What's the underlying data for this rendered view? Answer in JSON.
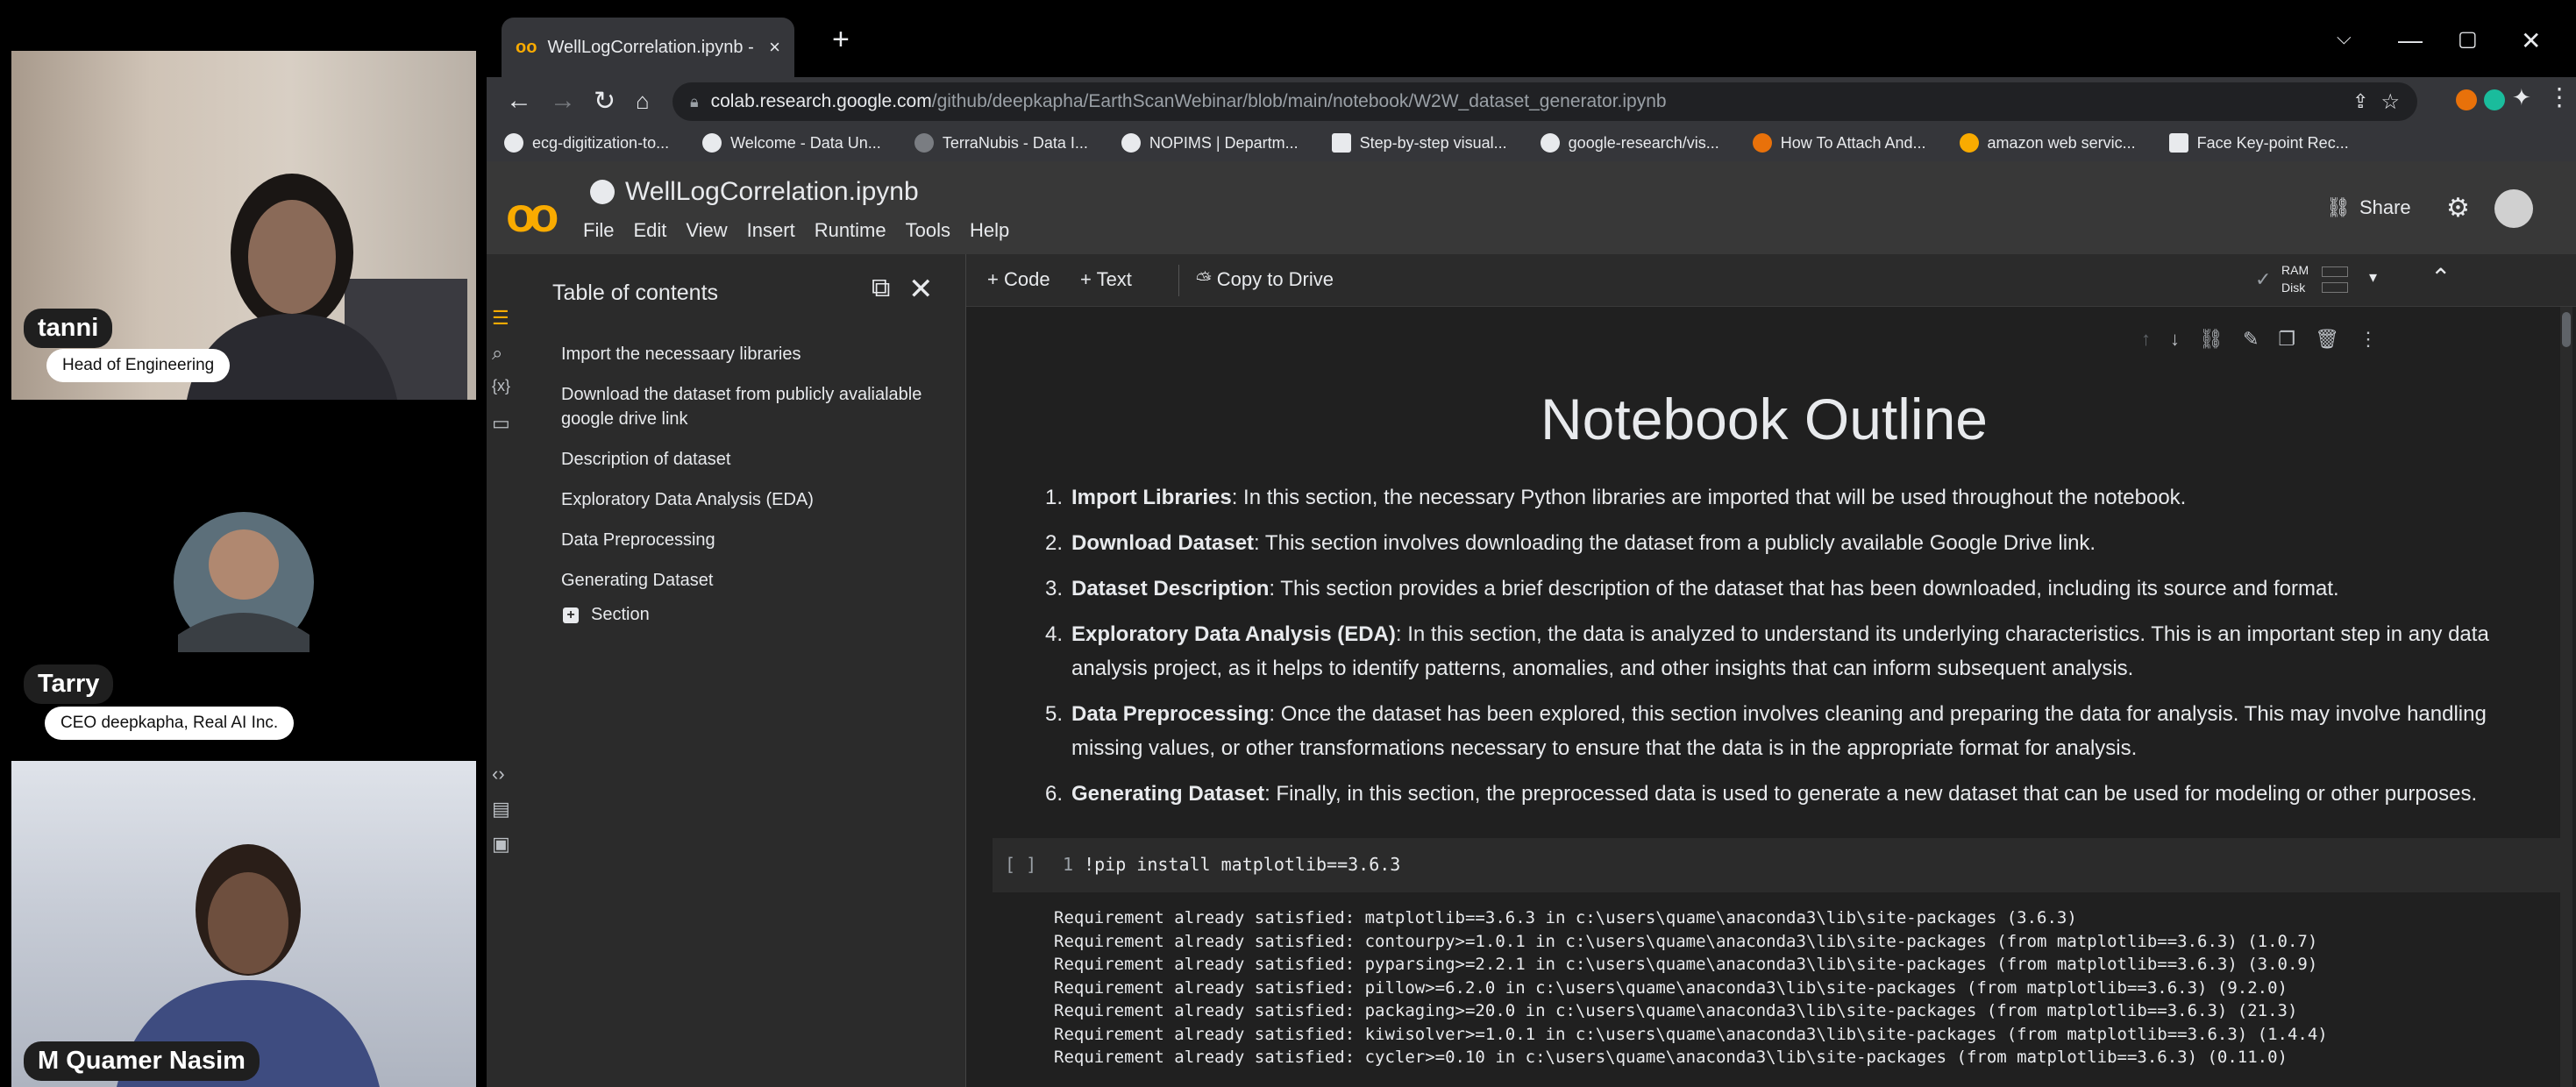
{
  "participants": [
    {
      "name": "tanni",
      "role": "Head of Engineering"
    },
    {
      "name": "Tarry",
      "role": "CEO deepkapha, Real AI Inc."
    },
    {
      "name": "M Quamer Nasim"
    }
  ],
  "browser": {
    "tab_title": "WellLogCorrelation.ipynb - Colab",
    "url_domain": "colab.research.google.com",
    "url_path": "/github/deepkapha/EarthScanWebinar/blob/main/notebook/W2W_dataset_generator.ipynb",
    "bookmarks": [
      "ecg-digitization-to...",
      "Welcome - Data Un...",
      "TerraNubis - Data I...",
      "NOPIMS | Departm...",
      "Step-by-step visual...",
      "google-research/vis...",
      "How To Attach And...",
      "amazon web servic...",
      "Face Key-point Rec..."
    ]
  },
  "colab": {
    "notebook_title": "WellLogCorrelation.ipynb",
    "menu": [
      "File",
      "Edit",
      "View",
      "Insert",
      "Runtime",
      "Tools",
      "Help"
    ],
    "share_label": "Share",
    "toolbar": {
      "code": "+ Code",
      "text": "+ Text",
      "copy_to_drive": "Copy to Drive",
      "ram": "RAM",
      "disk": "Disk"
    },
    "toc": {
      "title": "Table of contents",
      "items": [
        "Import the necessaary libraries",
        "Download the dataset from publicly avalialable google drive link",
        "Description of dataset",
        "Exploratory Data Analysis (EDA)",
        "Data Preprocessing",
        "Generating Dataset"
      ],
      "add_section": "Section"
    },
    "outline": {
      "heading": "Notebook Outline",
      "items": [
        {
          "num": "1.",
          "bold": "Import Libraries",
          "text": ": In this section, the necessary Python libraries are imported that will be used throughout the notebook."
        },
        {
          "num": "2.",
          "bold": "Download Dataset",
          "text": ": This section involves downloading the dataset from a publicly available Google Drive link."
        },
        {
          "num": "3.",
          "bold": "Dataset Description",
          "text": ": This section provides a brief description of the dataset that has been downloaded, including its source and format."
        },
        {
          "num": "4.",
          "bold": "Exploratory Data Analysis (EDA)",
          "text": ": In this section, the data is analyzed to understand its underlying characteristics. This is an important step in any data analysis project, as it helps to identify patterns, anomalies, and other insights that can inform subsequent analysis."
        },
        {
          "num": "5.",
          "bold": "Data Preprocessing",
          "text": ": Once the dataset has been explored, this section involves cleaning and preparing the data for analysis. This may involve handling missing values, or other transformations necessary to ensure that the data is in the appropriate format for analysis."
        },
        {
          "num": "6.",
          "bold": "Generating Dataset",
          "text": ": Finally, in this section, the preprocessed data is used to generate a new dataset that can be used for modeling or other purposes."
        }
      ]
    },
    "code_cell": {
      "bracket": "[ ]",
      "line_no": "1",
      "code": "!pip install matplotlib==3.6.3",
      "output": [
        "Requirement already satisfied: matplotlib==3.6.3 in c:\\users\\quame\\anaconda3\\lib\\site-packages (3.6.3)",
        "Requirement already satisfied: contourpy>=1.0.1 in c:\\users\\quame\\anaconda3\\lib\\site-packages (from matplotlib==3.6.3) (1.0.7)",
        "Requirement already satisfied: pyparsing>=2.2.1 in c:\\users\\quame\\anaconda3\\lib\\site-packages (from matplotlib==3.6.3) (3.0.9)",
        "Requirement already satisfied: pillow>=6.2.0 in c:\\users\\quame\\anaconda3\\lib\\site-packages (from matplotlib==3.6.3) (9.2.0)",
        "Requirement already satisfied: packaging>=20.0 in c:\\users\\quame\\anaconda3\\lib\\site-packages (from matplotlib==3.6.3) (21.3)",
        "Requirement already satisfied: kiwisolver>=1.0.1 in c:\\users\\quame\\anaconda3\\lib\\site-packages (from matplotlib==3.6.3) (1.4.4)",
        "Requirement already satisfied: cycler>=0.10 in c:\\users\\quame\\anaconda3\\lib\\site-packages (from matplotlib==3.6.3) (0.11.0)"
      ]
    }
  },
  "colors": {
    "colab_orange": "#f9ab00",
    "dark_bg": "#202124",
    "panel": "#2b2b2b"
  }
}
